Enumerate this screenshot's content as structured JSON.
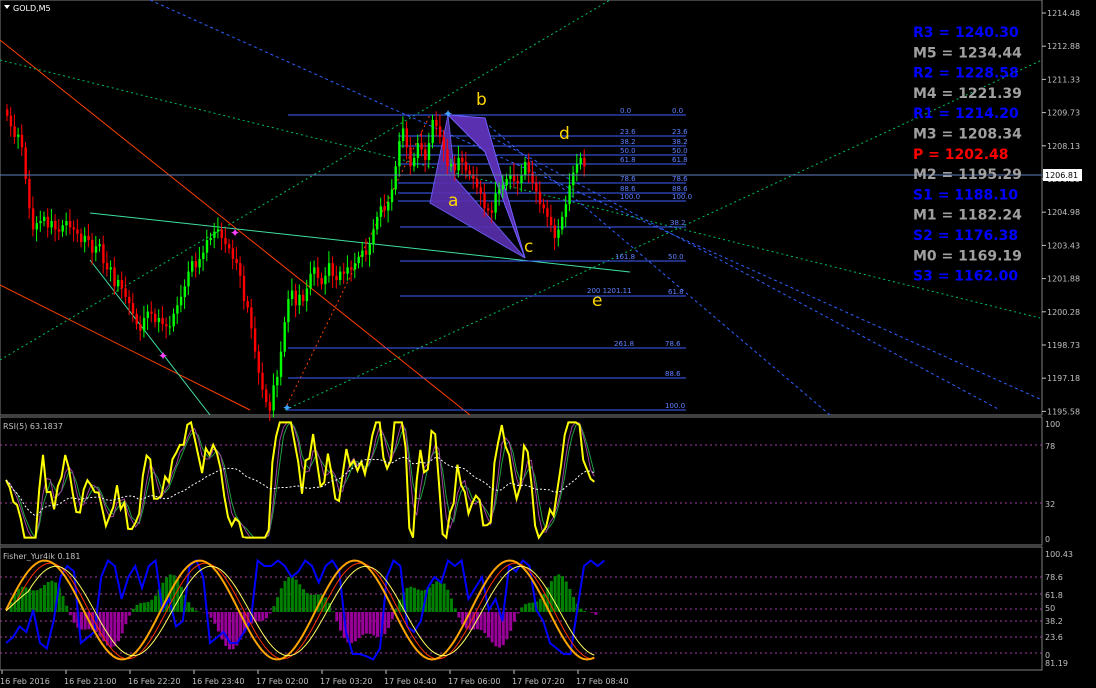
{
  "window": {
    "title": "GOLD,M5",
    "dropdown_icon": "triangle-down-icon"
  },
  "main": {
    "price_axis": [
      "1214.48",
      "1212.88",
      "1211.33",
      "1209.73",
      "1208.13",
      "1206.53",
      "1204.98",
      "1203.43",
      "1201.88",
      "1200.28",
      "1198.73",
      "1197.18",
      "1195.58"
    ],
    "current_price": "1206.81",
    "pivots": [
      {
        "label": "R3 = 1240.30",
        "color": "#0000ff"
      },
      {
        "label": "M5 = 1234.44",
        "color": "#a0a0a0"
      },
      {
        "label": "R2 = 1228.58",
        "color": "#0000ff"
      },
      {
        "label": "M4 = 1221.39",
        "color": "#a0a0a0"
      },
      {
        "label": "R1 = 1214.20",
        "color": "#0000ff"
      },
      {
        "label": "M3 = 1208.34",
        "color": "#a0a0a0"
      },
      {
        "label": "P  = 1202.48",
        "color": "#ff0000"
      },
      {
        "label": "M2 = 1195.29",
        "color": "#a0a0a0"
      },
      {
        "label": "S1 = 1188.10",
        "color": "#0000ff"
      },
      {
        "label": "M1 = 1182.24",
        "color": "#a0a0a0"
      },
      {
        "label": "S2 = 1176.38",
        "color": "#0000ff"
      },
      {
        "label": "M0 = 1169.19",
        "color": "#a0a0a0"
      },
      {
        "label": "S3 = 1162.00",
        "color": "#0000ff"
      }
    ],
    "pattern_points": [
      "a",
      "b",
      "c",
      "d",
      "e"
    ],
    "fib_levels_left": [
      "0.0",
      "23.6",
      "38.2",
      "50.0",
      "61.8",
      "78.6",
      "88.6",
      "100.0"
    ],
    "fib_levels_right": [
      "0.0",
      "23.6",
      "38.2",
      "50.0",
      "61.8",
      "78.6",
      "88.6",
      "100.0"
    ],
    "fib_ext": [
      "161.8",
      "200 1201.11",
      "261.8"
    ],
    "fib_lower": [
      "78.6",
      "88.6",
      "100.0"
    ],
    "closes": [
      1209.6,
      1209.1,
      1208.6,
      1208.7,
      1208.1,
      1206.6,
      1205.2,
      1204.2,
      1204.5,
      1204.6,
      1204.8,
      1204.3,
      1204.6,
      1204.2,
      1204.1,
      1204.4,
      1204.6,
      1204.3,
      1204.2,
      1204.0,
      1203.6,
      1203.9,
      1203.7,
      1203.1,
      1203.4,
      1203.5,
      1202.6,
      1202.3,
      1202.4,
      1201.5,
      1201.8,
      1201.4,
      1201.0,
      1200.7,
      1200.2,
      1199.7,
      1199.4,
      1200.0,
      1200.3,
      1200.2,
      1199.8,
      1200.0,
      1199.7,
      1199.6,
      1199.6,
      1200.2,
      1200.6,
      1201.0,
      1201.5,
      1202.2,
      1202.7,
      1202.4,
      1202.8,
      1203.1,
      1203.7,
      1203.8,
      1204.1,
      1204.2,
      1203.8,
      1203.5,
      1203.3,
      1202.8,
      1202.6,
      1202.0,
      1200.8,
      1200.5,
      1199.5,
      1198.4,
      1197.4,
      1196.6,
      1196.0,
      1195.6,
      1196.8,
      1197.2,
      1198.4,
      1199.8,
      1200.9,
      1201.3,
      1200.6,
      1201.1,
      1200.8,
      1201.4,
      1202.1,
      1202.4,
      1201.9,
      1201.6,
      1202.0,
      1202.6,
      1202.0,
      1201.8,
      1202.2,
      1202.1,
      1202.4,
      1202.3,
      1202.6,
      1202.9,
      1203.2,
      1203.0,
      1203.5,
      1204.2,
      1204.8,
      1205.3,
      1205.1,
      1205.5,
      1206.1,
      1207.2,
      1208.4,
      1209.0,
      1208.1,
      1207.2,
      1207.6,
      1208.3,
      1208.0,
      1207.5,
      1208.3,
      1209.4,
      1209.1,
      1208.6,
      1208.0,
      1207.2,
      1207.3,
      1207.0,
      1207.6,
      1207.4,
      1207.0,
      1206.8,
      1206.6,
      1206.2,
      1205.9,
      1205.2,
      1205.1,
      1205.0,
      1205.9,
      1206.1,
      1206.3,
      1206.6,
      1206.8,
      1206.5,
      1206.4,
      1206.8,
      1207.4,
      1206.9,
      1206.4,
      1206.0,
      1205.4,
      1205.2,
      1204.8,
      1204.4,
      1203.8,
      1204.2,
      1204.8,
      1205.4,
      1206.3,
      1206.9,
      1207.3,
      1207.6,
      1207.2
    ],
    "stoch_blue": [
      0.2,
      0.25,
      0.35,
      0.3,
      0.5,
      0.2,
      0.15,
      0.4,
      0.8,
      0.9,
      0.85,
      0.2,
      0.25,
      0.3,
      0.8,
      0.95,
      0.9,
      0.6,
      0.8,
      0.9,
      0.7,
      0.9,
      0.95,
      0.5,
      0.6,
      0.35,
      0.4,
      0.9,
      0.95,
      0.8,
      0.2,
      0.25,
      0.3,
      0.2,
      0.2,
      0.3,
      0.4,
      0.95,
      0.9,
      0.9,
      0.95,
      0.9,
      0.8,
      0.85,
      0.95,
      0.9,
      0.75,
      0.9,
      0.95,
      0.85,
      0.3,
      0.1,
      0.1,
      0.08,
      0.05,
      0.15,
      0.8,
      0.95,
      0.9,
      0.35,
      0.3,
      0.4,
      0.7,
      0.8,
      0.75,
      0.95,
      0.9,
      0.95,
      0.6,
      0.7,
      0.8,
      0.5,
      0.6,
      0.4,
      0.9,
      0.85,
      0.95,
      0.9,
      0.5,
      0.4,
      0.2,
      0.15,
      0.1,
      0.1,
      0.5,
      0.9,
      0.95,
      0.9,
      0.95
    ]
  },
  "indicators": {
    "rsi": {
      "label": "RSI(5) 63.1837",
      "scale": [
        "100",
        "78",
        "32",
        "0"
      ]
    },
    "fisher": {
      "label": "Fisher_Yur4ik 0.181",
      "scale": [
        "100.43",
        "78.6",
        "61.8",
        "50",
        "38.2",
        "23.6",
        "0",
        "81.19"
      ]
    }
  },
  "time_axis": [
    "16 Feb 2016",
    "16 Feb 21:00",
    "16 Feb 22:20",
    "16 Feb 23:40",
    "17 Feb 02:00",
    "17 Feb 03:20",
    "17 Feb 04:40",
    "17 Feb 06:00",
    "17 Feb 07:20",
    "17 Feb 08:40"
  ],
  "colors": {
    "bull": "#00ff00",
    "bear": "#ff0000",
    "grid": "#3a3a3a",
    "axis": "#c0c0c0",
    "fib": "#4060ff",
    "pattern_fill": "#5a2fb0",
    "pattern_label": "#ffd700",
    "rsi": "#ffff00",
    "fisher_blue": "#0000ff",
    "fisher_orange": "#ffa500",
    "hist_green": "#008000",
    "hist_magenta": "#990099"
  }
}
